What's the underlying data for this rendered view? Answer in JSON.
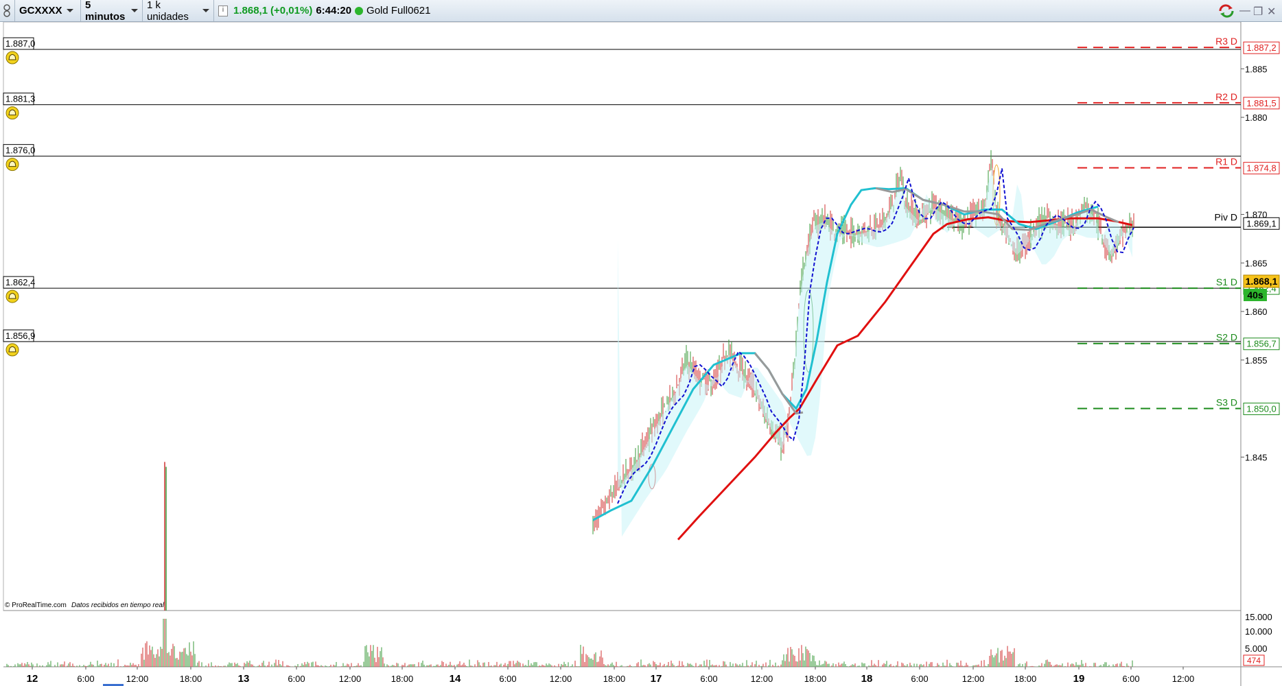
{
  "toolbar": {
    "symbol": "GCXXXX",
    "timeframe": "5 minutos",
    "units": "1 k unidades",
    "price": "1.868,1",
    "change": "(+0,01%)",
    "time": "6:44:20",
    "feed_name": "Gold Full0621"
  },
  "chart": {
    "alert_levels": [
      "1.887,0",
      "1.881,3",
      "1.876,0",
      "1.862,4",
      "1.856,9"
    ],
    "pivots": [
      {
        "label": "R3 D",
        "value": "1.887,2",
        "color": "#e02020"
      },
      {
        "label": "R2 D",
        "value": "1.881,5",
        "color": "#e02020"
      },
      {
        "label": "R1 D",
        "value": "1.874,8",
        "color": "#e02020"
      },
      {
        "label": "Piv D",
        "value": "1.869,1",
        "color": "#000000"
      },
      {
        "label": "S1 D",
        "value": "1.862,4",
        "color": "#1a8a1a"
      },
      {
        "label": "S2 D",
        "value": "1.856,7",
        "color": "#1a8a1a"
      },
      {
        "label": "S3 D",
        "value": "1.850,0",
        "color": "#1a8a1a"
      }
    ],
    "y_axis_ticks": [
      "1.885",
      "1.880",
      "1.870",
      "1.865",
      "1.860",
      "1.855",
      "1.845"
    ],
    "last_price_badge": "1.868,1",
    "countdown": "40s",
    "credit": "© ProRealTime.com",
    "credit_note": "Datos recibidos en tiempo real",
    "volume_ticks": [
      "15.000",
      "10.000",
      "5.000"
    ],
    "volume_last": "474",
    "x_axis_labels": [
      "12",
      "6:00",
      "12:00",
      "18:00",
      "13",
      "6:00",
      "12:00",
      "18:00",
      "14",
      "6:00",
      "12:00",
      "18:00",
      "17",
      "6:00",
      "12:00",
      "18:00",
      "18",
      "6:00",
      "12:00",
      "18:00",
      "19",
      "6:00",
      "12:00"
    ],
    "colors": {
      "up": "#3a9a3a",
      "down": "#d03030",
      "ma_fast": "#20c0d0",
      "ma_slow": "#e01010",
      "ma_dash": "#1010d0",
      "ma_gray": "#999999"
    }
  }
}
